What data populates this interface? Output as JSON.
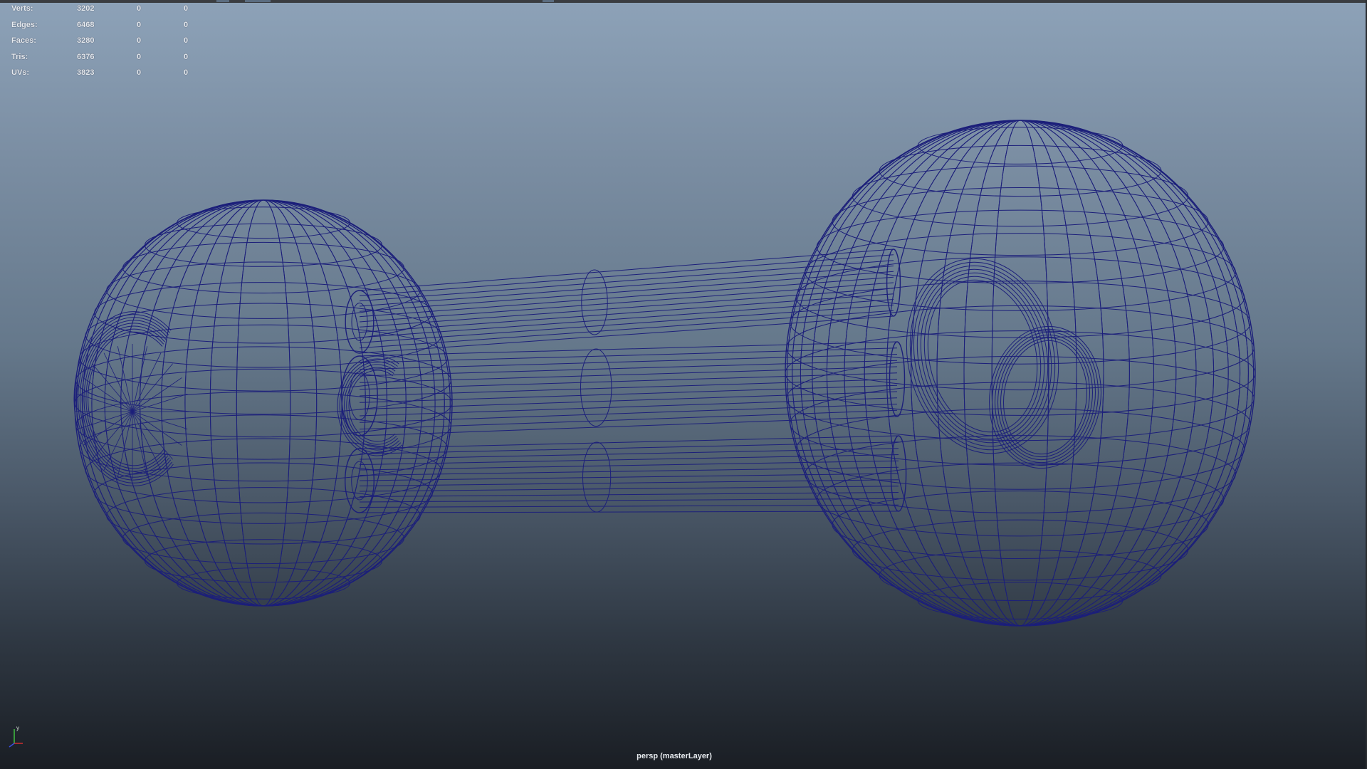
{
  "hud": {
    "rows": [
      {
        "label": "Verts:",
        "v1": "3202",
        "v2": "0",
        "v3": "0"
      },
      {
        "label": "Edges:",
        "v1": "6468",
        "v2": "0",
        "v3": "0"
      },
      {
        "label": "Faces:",
        "v1": "3280",
        "v2": "0",
        "v3": "0"
      },
      {
        "label": "Tris:",
        "v1": "6376",
        "v2": "0",
        "v3": "0"
      },
      {
        "label": "UVs:",
        "v1": "3823",
        "v2": "0",
        "v3": "0"
      }
    ]
  },
  "viewport": {
    "camera_label": "persp (masterLayer)",
    "wire_color": "#1c1f7a",
    "background_top": "#8da2b8",
    "background_bottom": "#1a1e24"
  },
  "axis_indicator": {
    "y_label": "y",
    "x_color": "#d03030",
    "y_color": "#40c040",
    "z_color": "#3a50e0"
  }
}
